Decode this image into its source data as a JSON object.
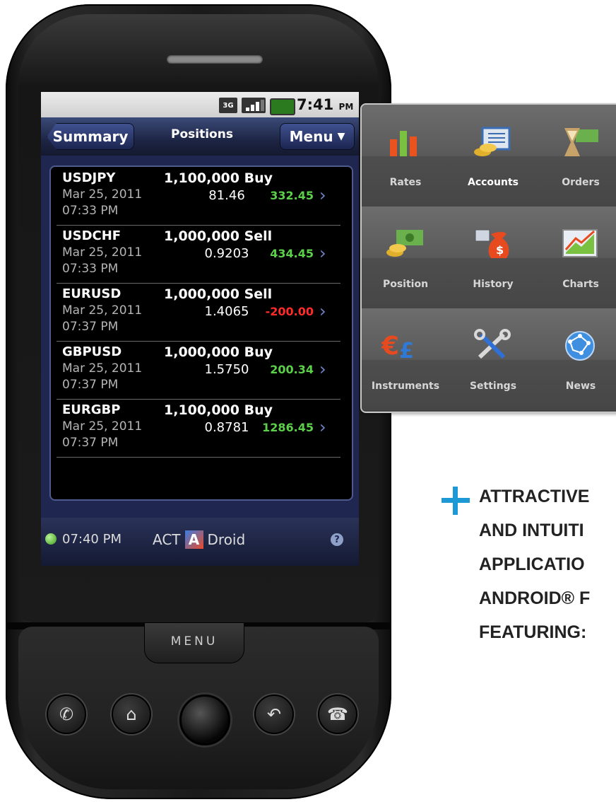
{
  "status_bar": {
    "network": "3G",
    "time": "7:41",
    "ampm": "PM"
  },
  "nav": {
    "back_label": "Summary",
    "title": "Positions",
    "menu_label": "Menu"
  },
  "positions": [
    {
      "pair": "USDJPY",
      "amount": "1,100,000 Buy",
      "date": "Mar 25, 2011",
      "time": "07:33 PM",
      "price": "81.46",
      "pl": "332.45",
      "pl_color": "#5cd04a"
    },
    {
      "pair": "USDCHF",
      "amount": "1,000,000 Sell",
      "date": "Mar 25, 2011",
      "time": "07:33 PM",
      "price": "0.9203",
      "pl": "434.45",
      "pl_color": "#5cd04a"
    },
    {
      "pair": "EURUSD",
      "amount": "1,000,000 Sell",
      "date": "Mar 25, 2011",
      "time": "07:37 PM",
      "price": "1.4065",
      "pl": "-200.00",
      "pl_color": "#ff2a2a"
    },
    {
      "pair": "GBPUSD",
      "amount": "1,000,000 Buy",
      "date": "Mar 25, 2011",
      "time": "07:37 PM",
      "price": "1.5750",
      "pl": "200.34",
      "pl_color": "#5cd04a"
    },
    {
      "pair": "EURGBP",
      "amount": "1,100,000 Buy",
      "date": "Mar 25, 2011",
      "time": "07:37 PM",
      "price": "0.8781",
      "pl": "1286.45",
      "pl_color": "#5cd04a"
    }
  ],
  "bottom_bar": {
    "time": "07:40 PM",
    "brand_left": "ACT",
    "brand_right": "Droid"
  },
  "hardware": {
    "menu_label": "MENU"
  },
  "menu_grid": [
    {
      "label": "Rates",
      "icon": "bar-chart-icon",
      "highlight": false
    },
    {
      "label": "Accounts",
      "icon": "ledger-coins-icon",
      "highlight": true
    },
    {
      "label": "Orders",
      "icon": "hourglass-cash-icon",
      "highlight": false
    },
    {
      "label": "Position",
      "icon": "cash-coins-icon",
      "highlight": false
    },
    {
      "label": "History",
      "icon": "money-bag-icon",
      "highlight": false
    },
    {
      "label": "Charts",
      "icon": "line-chart-icon",
      "highlight": false
    },
    {
      "label": "Instruments",
      "icon": "currency-symbols-icon",
      "highlight": false
    },
    {
      "label": "Settings",
      "icon": "tools-icon",
      "highlight": false
    },
    {
      "label": "News",
      "icon": "globe-icon",
      "highlight": false
    }
  ],
  "tagline": [
    "ATTRACTIVE",
    "AND INTUITI",
    "APPLICATIO",
    "ANDROID® F",
    "FEATURING:"
  ]
}
